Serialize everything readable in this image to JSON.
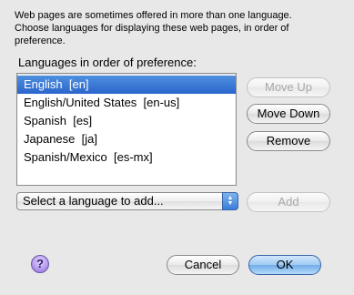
{
  "description": {
    "lines": [
      "Web pages are sometimes offered in more than one language.",
      "Choose languages for displaying these web pages, in order of",
      "preference."
    ]
  },
  "languages": {
    "label": "Languages in order of preference:",
    "items": [
      {
        "label": "English  [en]",
        "selected": true
      },
      {
        "label": "English/United States  [en-us]",
        "selected": false
      },
      {
        "label": "Spanish  [es]",
        "selected": false
      },
      {
        "label": "Japanese  [ja]",
        "selected": false
      },
      {
        "label": "Spanish/Mexico  [es-mx]",
        "selected": false
      }
    ]
  },
  "buttons": {
    "move_up": "Move Up",
    "move_down": "Move Down",
    "remove": "Remove",
    "add": "Add",
    "cancel": "Cancel",
    "ok": "OK"
  },
  "add_language": {
    "selected": "Select a language to add..."
  },
  "icons": {
    "help": "?",
    "popup_up": "▲",
    "popup_down": "▼"
  },
  "colors": {
    "selection": "#2a66cc",
    "default_button": "#72abe8",
    "help_button": "#a88be6"
  }
}
